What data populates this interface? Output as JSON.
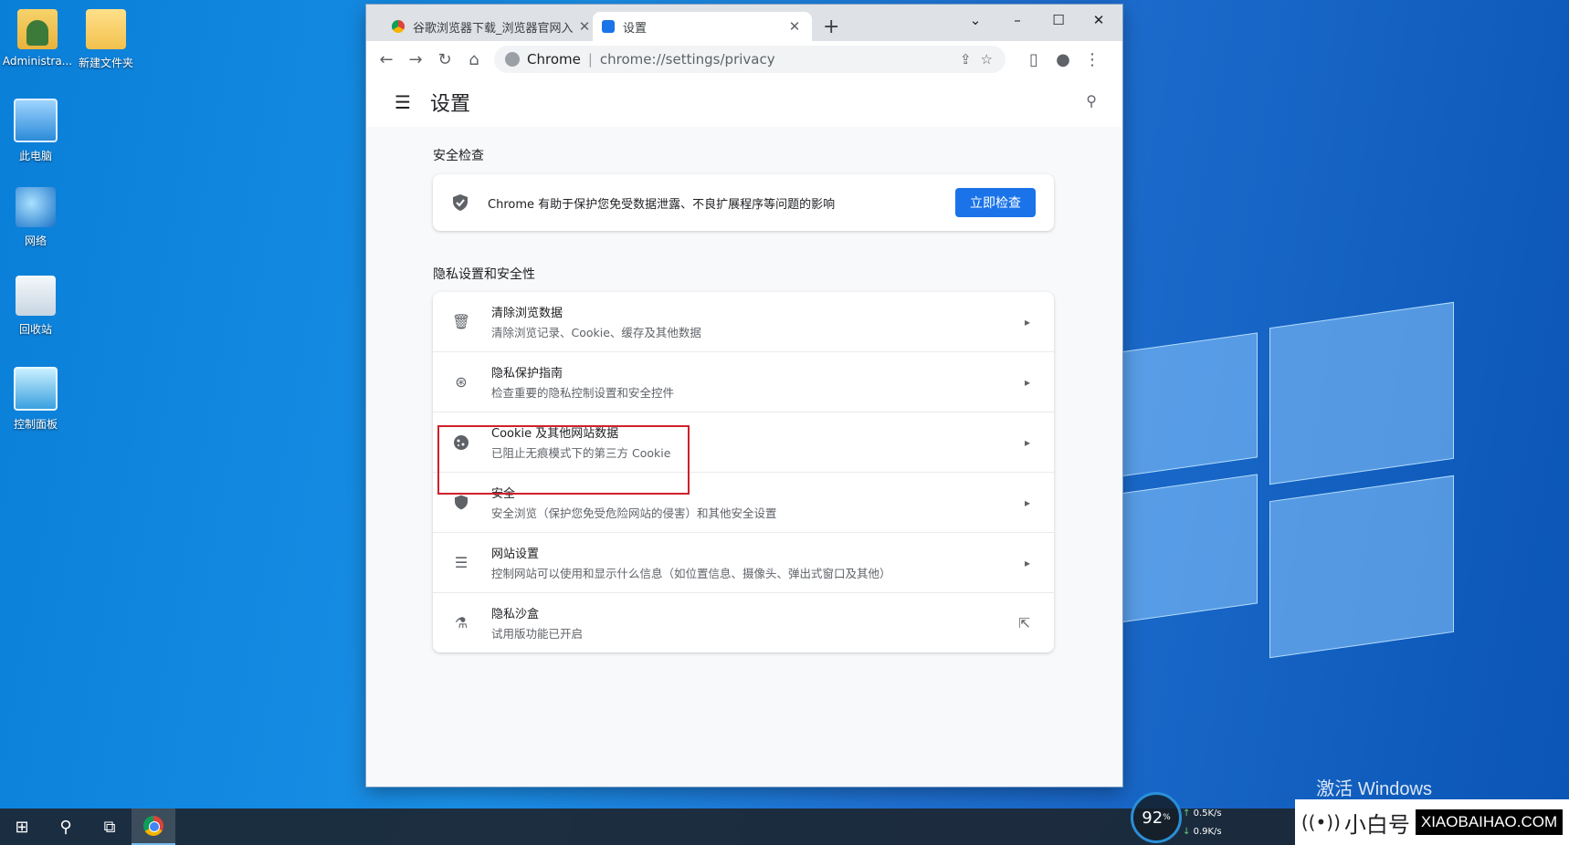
{
  "desktop": {
    "icons": [
      {
        "label": "Administra..."
      },
      {
        "label": "新建文件夹"
      },
      {
        "label": "此电脑"
      },
      {
        "label": "网络"
      },
      {
        "label": "回收站"
      },
      {
        "label": "控制面板"
      }
    ],
    "activation_text": "激活 Windows"
  },
  "browser": {
    "tabs": [
      {
        "title": "谷歌浏览器下载_浏览器官网入口",
        "close": "✕"
      },
      {
        "title": "设置",
        "close": "✕"
      }
    ],
    "new_tab": "+",
    "window_controls": {
      "dropdown": "⌄",
      "minimize": "–",
      "maximize": "☐",
      "close": "✕"
    },
    "omnibox": {
      "site": "Chrome",
      "separator": "|",
      "url": "chrome://settings/privacy"
    }
  },
  "settings": {
    "title": "设置",
    "safety_check": {
      "heading": "安全检查",
      "text": "Chrome 有助于保护您免受数据泄露、不良扩展程序等问题的影响",
      "button": "立即检查"
    },
    "privacy": {
      "heading": "隐私设置和安全性",
      "items": [
        {
          "title": "清除浏览数据",
          "subtitle": "清除浏览记录、Cookie、缓存及其他数据",
          "icon": "trash-icon"
        },
        {
          "title": "隐私保护指南",
          "subtitle": "检查重要的隐私控制设置和安全控件",
          "icon": "compass-icon"
        },
        {
          "title": "Cookie 及其他网站数据",
          "subtitle": "已阻止无痕模式下的第三方 Cookie",
          "icon": "cookie-icon"
        },
        {
          "title": "安全",
          "subtitle": "安全浏览（保护您免受危险网站的侵害）和其他安全设置",
          "icon": "shield-icon"
        },
        {
          "title": "网站设置",
          "subtitle": "控制网站可以使用和显示什么信息（如位置信息、摄像头、弹出式窗口及其他）",
          "icon": "sliders-icon"
        },
        {
          "title": "隐私沙盒",
          "subtitle": "试用版功能已开启",
          "icon": "flask-icon"
        }
      ]
    }
  },
  "taskbar": {
    "cpu": "92",
    "cpu_unit": "%",
    "upload": "0.5K/s",
    "download": "0.9K/s"
  },
  "brand": {
    "cn": "小白号",
    "en": "XIAOBAIHAO.COM"
  }
}
